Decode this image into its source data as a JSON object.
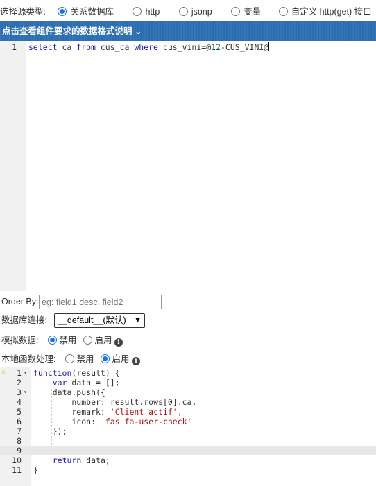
{
  "source_type": {
    "label": "选择源类型:",
    "options": [
      {
        "label": "关系数据库",
        "checked": true
      },
      {
        "label": "http",
        "checked": false
      },
      {
        "label": "jsonp",
        "checked": false
      },
      {
        "label": "变量",
        "checked": false
      },
      {
        "label": "自定义 http(get) 接口",
        "checked": false
      }
    ]
  },
  "info_bar": {
    "text": "点击查看组件要求的数据格式说明 ⌄"
  },
  "sql_editor": {
    "line_number": "1",
    "tokens": [
      "select",
      " ca ",
      "from",
      " cus_ca ",
      "where",
      " cus_vini=@",
      "12",
      "-CUS_VINI@"
    ]
  },
  "order_by": {
    "label": "Order By:",
    "placeholder": "eg: field1 desc, field2"
  },
  "db_connection": {
    "label": "数据库连接:",
    "value": "__default__(默认)"
  },
  "mock_data": {
    "label": "模拟数据:",
    "off_label": "禁用",
    "on_label": "启用",
    "selected": "off"
  },
  "local_func": {
    "label": "本地函数处理:",
    "off_label": "禁用",
    "on_label": "启用",
    "selected": "on"
  },
  "js_editor": {
    "lines": [
      {
        "n": "1",
        "fold": "▾",
        "parts": [
          [
            "function",
            "kw"
          ],
          [
            "(result) {",
            ""
          ]
        ]
      },
      {
        "n": "2",
        "fold": "",
        "parts": [
          [
            "    ",
            ""
          ],
          [
            "var",
            "kw"
          ],
          [
            " data = [];",
            ""
          ]
        ]
      },
      {
        "n": "3",
        "fold": "▾",
        "parts": [
          [
            "    data.push({",
            ""
          ]
        ]
      },
      {
        "n": "4",
        "fold": "",
        "parts": [
          [
            "        number: result.rows[0].ca,",
            ""
          ]
        ]
      },
      {
        "n": "5",
        "fold": "",
        "parts": [
          [
            "        remark: ",
            ""
          ],
          [
            "'Client actif'",
            "str"
          ],
          [
            ",",
            ""
          ]
        ]
      },
      {
        "n": "6",
        "fold": "",
        "parts": [
          [
            "        icon: ",
            ""
          ],
          [
            "'fas fa-user-check'",
            "str"
          ]
        ]
      },
      {
        "n": "7",
        "fold": "",
        "parts": [
          [
            "    });",
            ""
          ]
        ]
      },
      {
        "n": "8",
        "fold": "",
        "parts": [
          [
            "",
            ""
          ]
        ]
      },
      {
        "n": "9",
        "fold": "",
        "parts": [
          [
            "    ",
            ""
          ]
        ],
        "active": true
      },
      {
        "n": "10",
        "fold": "",
        "parts": [
          [
            "    ",
            ""
          ],
          [
            "return",
            "kw"
          ],
          [
            " data;",
            ""
          ]
        ]
      },
      {
        "n": "11",
        "fold": "",
        "parts": [
          [
            "}",
            ""
          ]
        ]
      }
    ]
  },
  "colors": {
    "accent": "#1a73e8",
    "bar": "#2a6db1"
  }
}
